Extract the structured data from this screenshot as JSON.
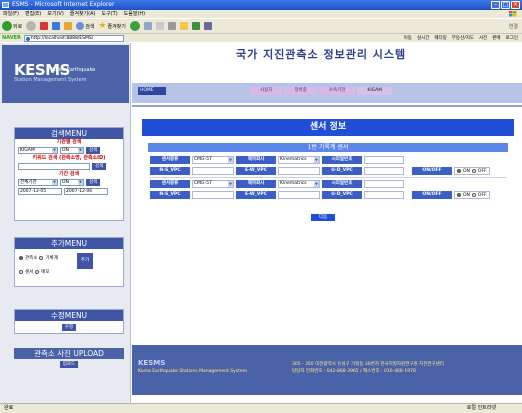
{
  "window": {
    "title": "ESMS - Microsoft Internet Explorer"
  },
  "menubar": [
    "파일(F)",
    "편집(E)",
    "보기(V)",
    "즐겨찾기(A)",
    "도구(T)",
    "도움말(H)"
  ],
  "toolbar": {
    "back": "뒤로",
    "search": "검색",
    "favorites": "즐겨찾기",
    "links": "연결"
  },
  "address": {
    "provider": "NAVER",
    "url": "http://localhost:8888/ESMS/",
    "right_items": [
      "이동",
      "실시간",
      "웨더링",
      "부동산/지도",
      "사전",
      "판매",
      "로그인"
    ]
  },
  "sidebar": {
    "logo_main": "KESMS",
    "logo_line1": "Korea Earthquake",
    "logo_line2": "Station Management System",
    "search_menu": {
      "title": "검색MENU",
      "by_org": "기관별 검색",
      "org_value": "KIGAM",
      "org_state": "ON",
      "org_btn": "검색",
      "by_keyword": "키워드 검색 (관측소명, 관측소ID)",
      "keyword_btn": "검색",
      "by_period": "기간 검색",
      "period_org": "전체기관",
      "period_state": "ON",
      "period_btn": "검색",
      "date_from": "2007-12-05",
      "date_to": "2007-12-06"
    },
    "add_menu": {
      "title": "추가MENU",
      "opt1": "관측소",
      "opt2": "기록계",
      "opt3": "센서",
      "opt4": "매모",
      "add_btn": "추가"
    },
    "edit_menu": {
      "title": "수정MENU",
      "btn": "수정"
    },
    "upload": {
      "title": "관측소 사진 UPLOAD",
      "btn": "업로드"
    }
  },
  "header": {
    "title": "국가 지진관측소 정보관리 시스템",
    "home": "HOME",
    "tabs": [
      "사용자",
      "정비중",
      "소속기관",
      "KIGAM"
    ]
  },
  "content": {
    "section_title": "센서 정보",
    "sub_title": "1번 기록계 센서",
    "rows": [
      {
        "type_label": "센서종류",
        "type_val": "CMG-5T",
        "maker_label": "제작회사",
        "maker_val": "Kinematrics",
        "serial_label": "시리얼번호",
        "serial_val": "",
        "ns_label": "N-S_VPC",
        "ns_val": "",
        "ew_label": "E-W_VPC",
        "ew_val": "",
        "ud_label": "U-D_VPC",
        "ud_val": "",
        "onoff_label": "ON/OFF",
        "on": "ON",
        "off": "OFF"
      },
      {
        "type_label": "센서종류",
        "type_val": "CMG-5T",
        "maker_label": "제작회사",
        "maker_val": "Kinematrics",
        "serial_label": "시리얼번호",
        "serial_val": "",
        "ns_label": "N-S_VPC",
        "ns_val": "",
        "ew_label": "E-W_VPC",
        "ew_val": "",
        "ud_label": "U-D_VPC",
        "ud_val": "",
        "onoff_label": "ON/OFF",
        "on": "ON",
        "off": "OFF"
      }
    ],
    "next_btn": "다음"
  },
  "footer": {
    "brand": "KESMS",
    "brand_sub": "Korea Earthquake Stations Management System",
    "addr": "305 - 350 대전광역시 유성구 가정동 30번지 한국지질자원연구원 지진연구센터",
    "contact": "담당자 전화번호 : 042-868-3965 / 팩스번호 : 016-468-1978"
  },
  "statusbar": {
    "left": "완료",
    "right": "로컬 인트라넷"
  }
}
